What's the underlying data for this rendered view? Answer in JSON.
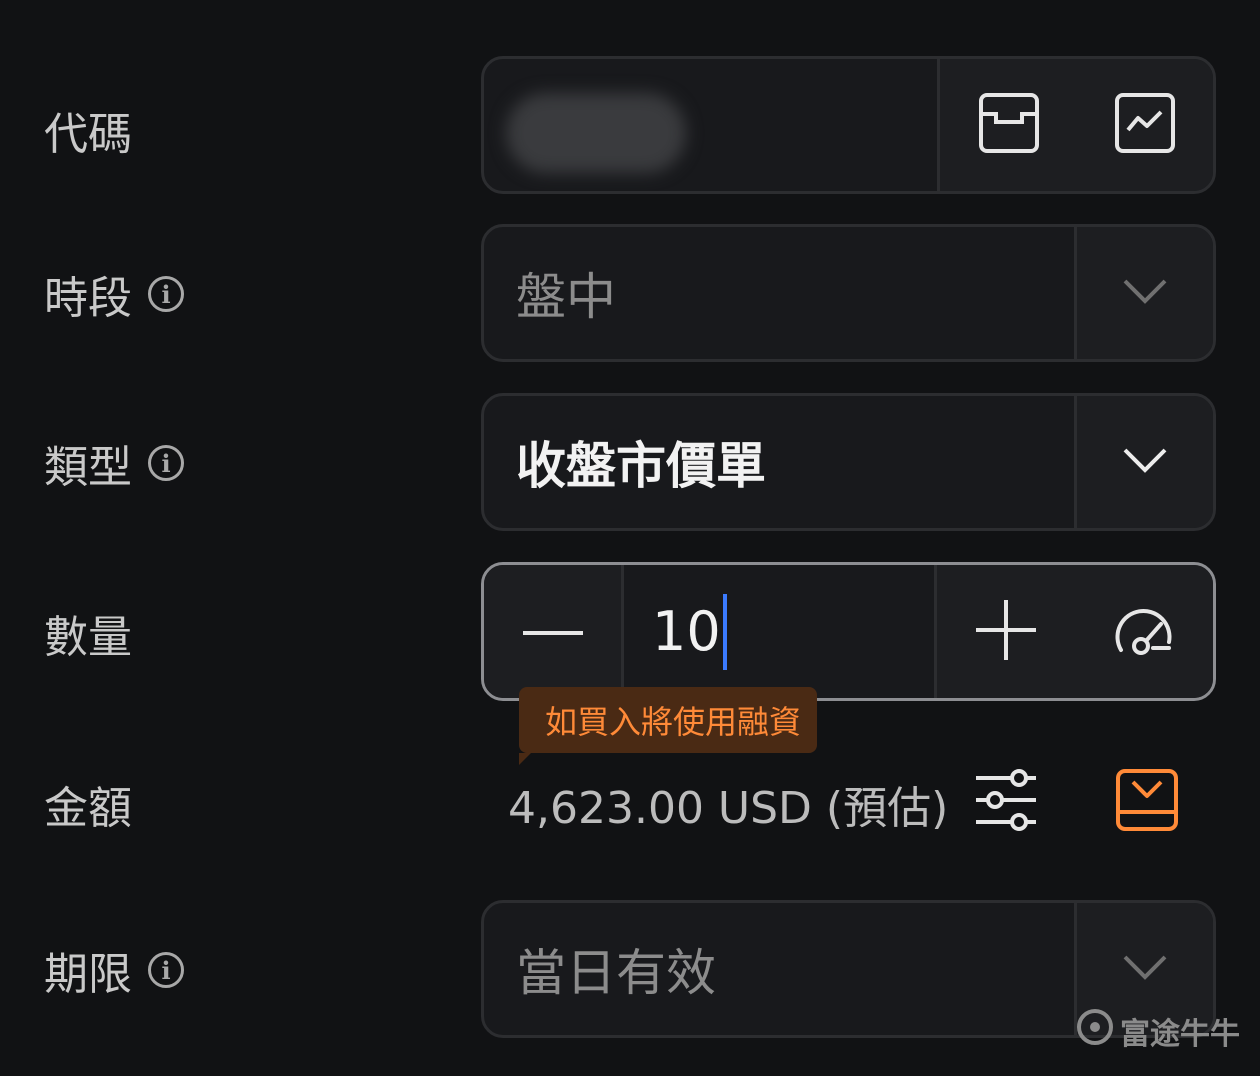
{
  "labels": {
    "code": "代碼",
    "session": "時段",
    "type": "類型",
    "quantity": "數量",
    "amount": "金額",
    "validity": "期限"
  },
  "info_icon_text": "i",
  "session": {
    "value": "盤中"
  },
  "order_type": {
    "value": "收盤市價單"
  },
  "quantity": {
    "value": "10"
  },
  "margin_tooltip": "如買入將使用融資",
  "amount": {
    "value": "4,623.00 USD (預估)"
  },
  "validity": {
    "value": "當日有效"
  },
  "watermark": "富途牛牛",
  "icons": {
    "code_left": "watchlist-box-icon",
    "code_right": "trend-chart-icon",
    "dropdown": "chevron-down-icon",
    "minus": "minus-icon",
    "plus": "plus-icon",
    "gauge": "gauge-icon",
    "settings": "sliders-icon",
    "order": "tray-download-icon"
  },
  "colors": {
    "background": "#111214",
    "accent_orange": "#ff8a38",
    "caret_blue": "#3b7bff"
  }
}
